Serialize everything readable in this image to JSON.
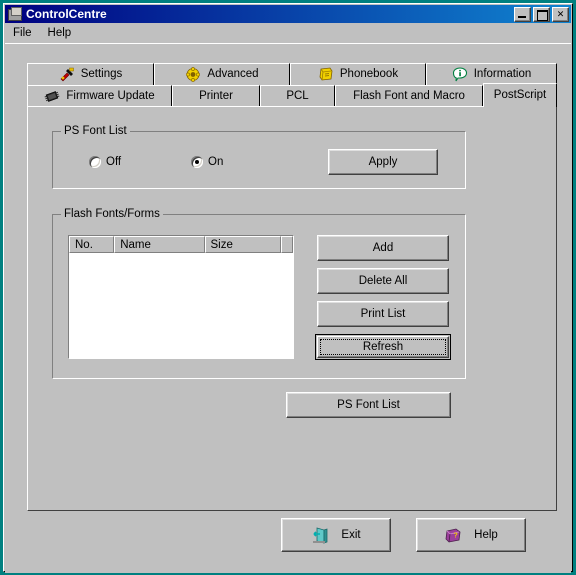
{
  "window": {
    "title": "ControlCentre",
    "icon": "app-chip-icon",
    "buttons": {
      "minimize": "minimize-button",
      "maximize": "maximize-button",
      "close": "close-button",
      "close_glyph": "✕"
    }
  },
  "menu": {
    "items": [
      {
        "label": "File",
        "name": "menu-file"
      },
      {
        "label": "Help",
        "name": "menu-help"
      }
    ]
  },
  "tabs": {
    "row1": [
      {
        "label": "Settings",
        "icon": "tools-icon",
        "selected": false
      },
      {
        "label": "Advanced",
        "icon": "gear-icon",
        "selected": false
      },
      {
        "label": "Phonebook",
        "icon": "address-book-icon",
        "selected": false
      },
      {
        "label": "Information",
        "icon": "info-bubble-icon",
        "selected": false
      }
    ],
    "row2": [
      {
        "label": "Firmware Update",
        "icon": "chip-icon",
        "selected": false
      },
      {
        "label": "Printer",
        "icon": "",
        "selected": false
      },
      {
        "label": "PCL",
        "icon": "",
        "selected": false
      },
      {
        "label": "Flash Font and Macro",
        "icon": "",
        "selected": false
      },
      {
        "label": "PostScript",
        "icon": "",
        "selected": true
      }
    ]
  },
  "ps_font_list_group": {
    "title": "PS Font List",
    "radios": [
      {
        "label": "Off",
        "checked": false
      },
      {
        "label": "On",
        "checked": true
      }
    ],
    "apply_button": "Apply"
  },
  "flash_fonts_group": {
    "title": "Flash Fonts/Forms",
    "list": {
      "columns": [
        "No.",
        "Name",
        "Size",
        ""
      ],
      "rows": []
    },
    "buttons": [
      {
        "label": "Add",
        "default": false
      },
      {
        "label": "Delete All",
        "default": false
      },
      {
        "label": "Print List",
        "default": false
      },
      {
        "label": "Refresh",
        "default": true
      }
    ]
  },
  "ps_font_list_button": "PS Font List",
  "bottom_buttons": [
    {
      "label": "Exit",
      "icon": "exit-door-icon"
    },
    {
      "label": "Help",
      "icon": "help-book-icon"
    }
  ],
  "colors": {
    "window_border": "#008080",
    "face": "#c0c0c0",
    "title_left": "#000080",
    "title_right": "#1084d0",
    "list_bg": "#ffffff"
  }
}
